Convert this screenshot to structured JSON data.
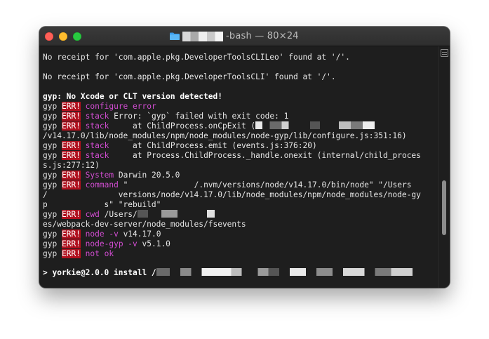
{
  "window": {
    "title": "-bash — 80×24"
  },
  "lines": [
    {
      "type": "plain",
      "text": "No receipt for 'com.apple.pkg.DeveloperToolsCLILeo' found at '/'."
    },
    {
      "type": "plain",
      "text": "No receipt for 'com.apple.pkg.DeveloperToolsCLI' found at '/'."
    },
    {
      "type": "bold",
      "text": "gyp: No Xcode or CLT version detected!"
    },
    {
      "type": "err",
      "label": "configure error",
      "rest": ""
    },
    {
      "type": "err",
      "label": "stack",
      "rest": " Error: `gyp` failed with exit code: 1"
    },
    {
      "type": "err",
      "label": "stack",
      "rest": "     at ChildProcess.onCpExit ("
    },
    {
      "type": "plain",
      "text": "/v14.17.0/lib/node_modules/npm/node_modules/node-gyp/lib/configure.js:351:16)"
    },
    {
      "type": "err",
      "label": "stack",
      "rest": "     at ChildProcess.emit (events.js:376:20)"
    },
    {
      "type": "err",
      "label": "stack",
      "rest": "     at Process.ChildProcess._handle.onexit (internal/child_proces"
    },
    {
      "type": "plain",
      "text": "s.js:277:12)"
    },
    {
      "type": "err",
      "label": "System",
      "rest": " Darwin 20.5.0"
    },
    {
      "type": "err",
      "label": "command",
      "rest": " \"              /.nvm/versions/node/v14.17.0/bin/node\" \"/Users"
    },
    {
      "type": "plain",
      "text": "/               versions/node/v14.17.0/lib/node_modules/npm/node_modules/node-gy"
    },
    {
      "type": "plain",
      "text": "p            s\" \"rebuild\""
    },
    {
      "type": "err",
      "label": "cwd",
      "rest": " /Users/"
    },
    {
      "type": "plain",
      "text": "es/webpack-dev-server/node_modules/fsevents"
    },
    {
      "type": "err",
      "label": "node -v",
      "rest": " v14.17.0"
    },
    {
      "type": "err",
      "label": "node-gyp -v",
      "rest": " v5.1.0"
    },
    {
      "type": "err",
      "label": "not ok",
      "rest": ""
    },
    {
      "type": "prompt",
      "text": "> yorkie@2.0.0 install /"
    }
  ],
  "gyp_prefix": "gyp",
  "err_badge": "ERR!"
}
